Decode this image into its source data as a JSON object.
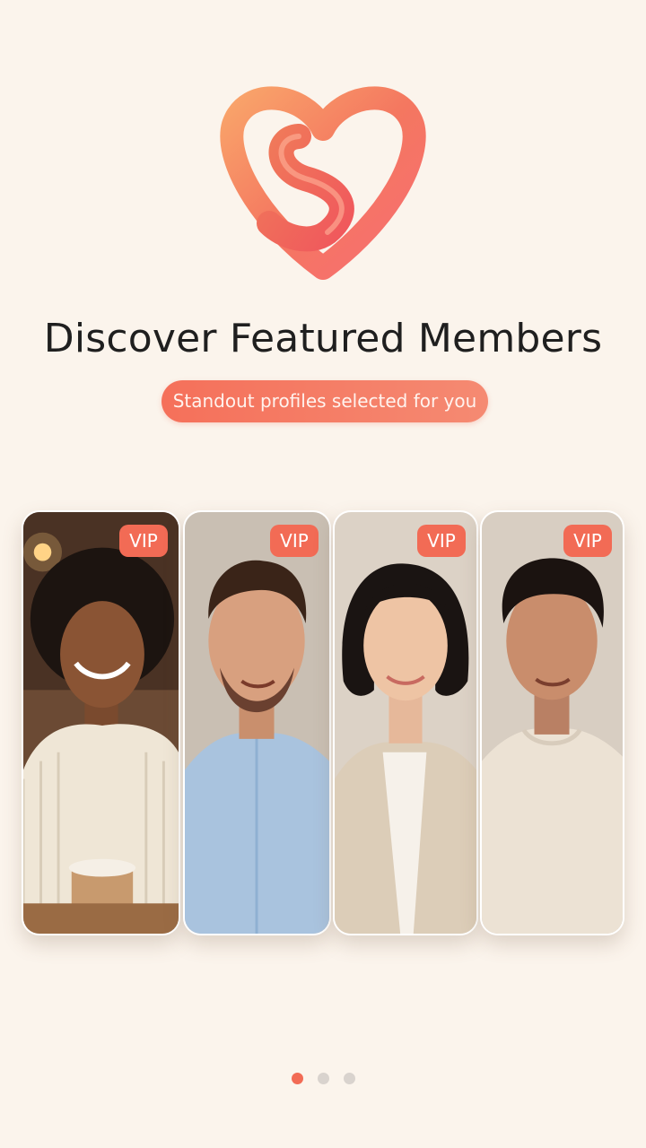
{
  "header": {
    "logo_icon": "heart-s-logo-icon",
    "title": "Discover Featured Members",
    "subtitle": "Standout profiles selected for you"
  },
  "featured": {
    "profiles": [
      {
        "badge": "VIP",
        "avatar": "woman-curly-hair-with-mug"
      },
      {
        "badge": "VIP",
        "avatar": "man-blue-shirt"
      },
      {
        "badge": "VIP",
        "avatar": "woman-bob-haircut-blazer"
      },
      {
        "badge": "VIP",
        "avatar": "man-cream-tshirt"
      }
    ]
  },
  "pagination": {
    "pages": 3,
    "active": 1
  },
  "colors": {
    "background": "#fbf4ec",
    "accent": "#f26b55",
    "inactive_dot": "#d9d3ce"
  }
}
